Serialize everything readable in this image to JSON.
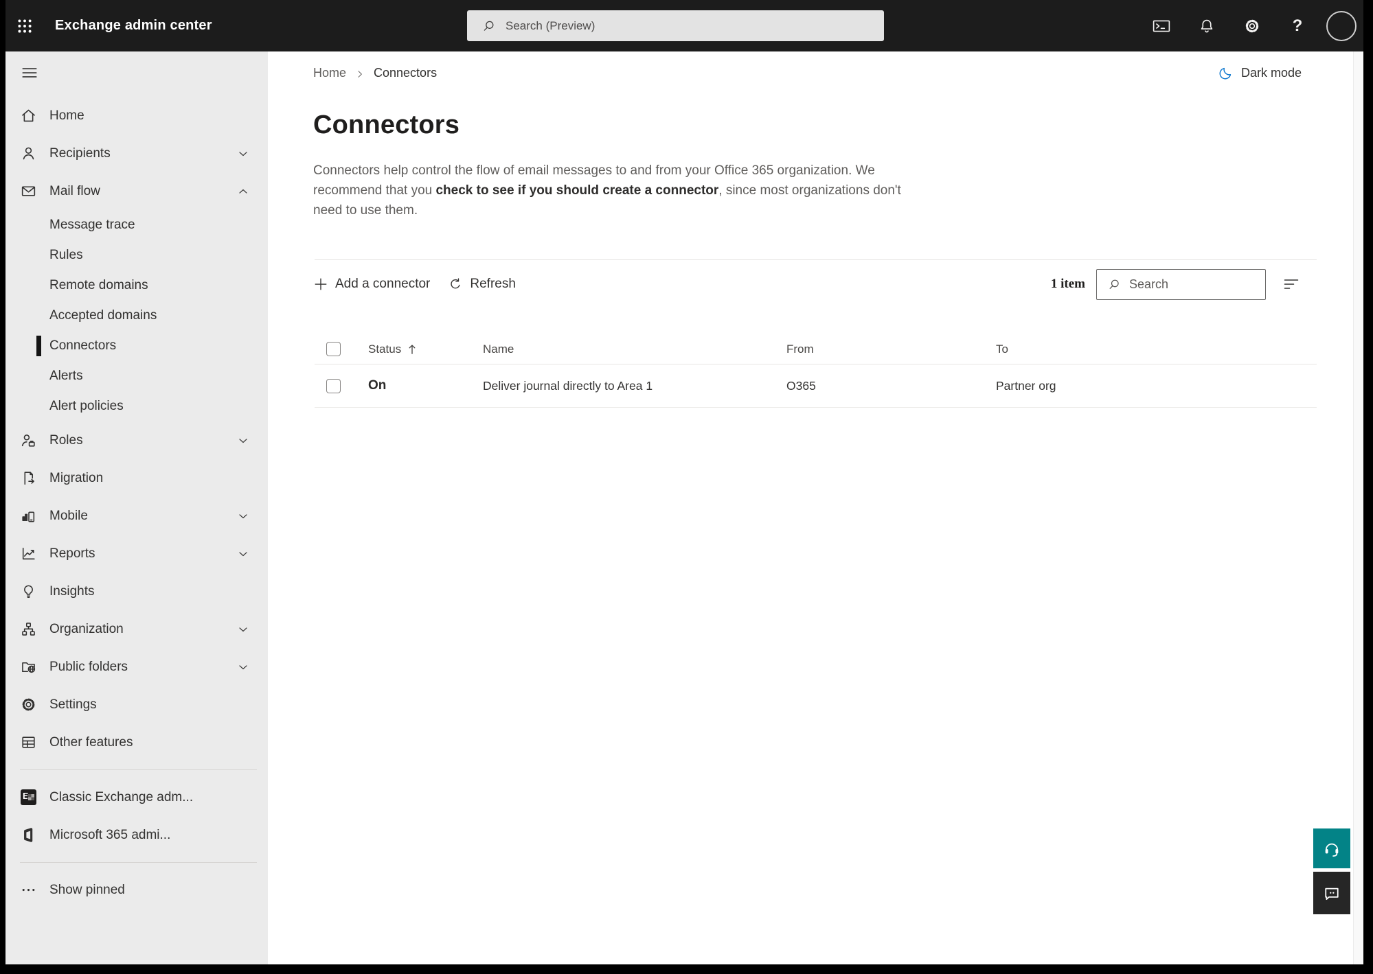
{
  "topbar": {
    "app_title": "Exchange admin center",
    "search_placeholder": "Search (Preview)",
    "icons": [
      "app-launcher-icon",
      "terminal-icon",
      "bell-icon",
      "gear-icon",
      "help-icon",
      "avatar"
    ]
  },
  "sidebar": {
    "items": [
      {
        "label": "Home",
        "icon": "home-icon",
        "type": "item"
      },
      {
        "label": "Recipients",
        "icon": "person-icon",
        "chevron": "down",
        "type": "item"
      },
      {
        "label": "Mail flow",
        "icon": "mail-icon",
        "chevron": "up",
        "type": "item"
      },
      {
        "label": "Message trace",
        "type": "sub"
      },
      {
        "label": "Rules",
        "type": "sub"
      },
      {
        "label": "Remote domains",
        "type": "sub"
      },
      {
        "label": "Accepted domains",
        "type": "sub"
      },
      {
        "label": "Connectors",
        "type": "sub",
        "selected": true
      },
      {
        "label": "Alerts",
        "type": "sub"
      },
      {
        "label": "Alert policies",
        "type": "sub"
      },
      {
        "label": "Roles",
        "icon": "roles-icon",
        "chevron": "down",
        "type": "item"
      },
      {
        "label": "Migration",
        "icon": "migration-icon",
        "type": "item"
      },
      {
        "label": "Mobile",
        "icon": "mobile-icon",
        "chevron": "down",
        "type": "item"
      },
      {
        "label": "Reports",
        "icon": "reports-icon",
        "chevron": "down",
        "type": "item"
      },
      {
        "label": "Insights",
        "icon": "insights-icon",
        "type": "item"
      },
      {
        "label": "Organization",
        "icon": "organization-icon",
        "chevron": "down",
        "type": "item"
      },
      {
        "label": "Public folders",
        "icon": "public-folders-icon",
        "chevron": "down",
        "type": "item"
      },
      {
        "label": "Settings",
        "icon": "settings-icon",
        "type": "item"
      },
      {
        "label": "Other features",
        "icon": "other-features-icon",
        "type": "item"
      },
      {
        "type": "divider"
      },
      {
        "label": "Classic Exchange adm...",
        "icon": "exchange-logo-icon",
        "type": "item"
      },
      {
        "label": "Microsoft 365 admi...",
        "icon": "m365-logo-icon",
        "type": "item"
      },
      {
        "type": "divider"
      },
      {
        "label": "Show pinned",
        "icon": "ellipsis-icon",
        "type": "item"
      }
    ]
  },
  "breadcrumb": {
    "home": "Home",
    "current": "Connectors"
  },
  "page": {
    "title": "Connectors",
    "desc_before": "Connectors help control the flow of email messages to and from your Office 365 organization. We recommend that you ",
    "desc_link": "check to see if you should create a connector",
    "desc_after": ", since most organizations don't need to use them.",
    "dark_mode_label": "Dark mode"
  },
  "toolbar": {
    "add_label": "Add a connector",
    "refresh_label": "Refresh",
    "item_count": "1 item",
    "search_placeholder": "Search"
  },
  "table": {
    "columns": {
      "status": "Status",
      "name": "Name",
      "from": "From",
      "to": "To"
    },
    "sort_column": "Status",
    "sort_direction": "ascending",
    "rows": [
      {
        "status": "On",
        "name": "Deliver journal directly to Area 1",
        "from": "O365",
        "to": "Partner org"
      }
    ]
  },
  "colors": {
    "topbar_bg": "#1c1c1c",
    "sidebar_bg": "#ebebeb",
    "accent_teal": "#038387",
    "feedback_dark": "#262626",
    "moon_blue": "#0b76ce"
  }
}
